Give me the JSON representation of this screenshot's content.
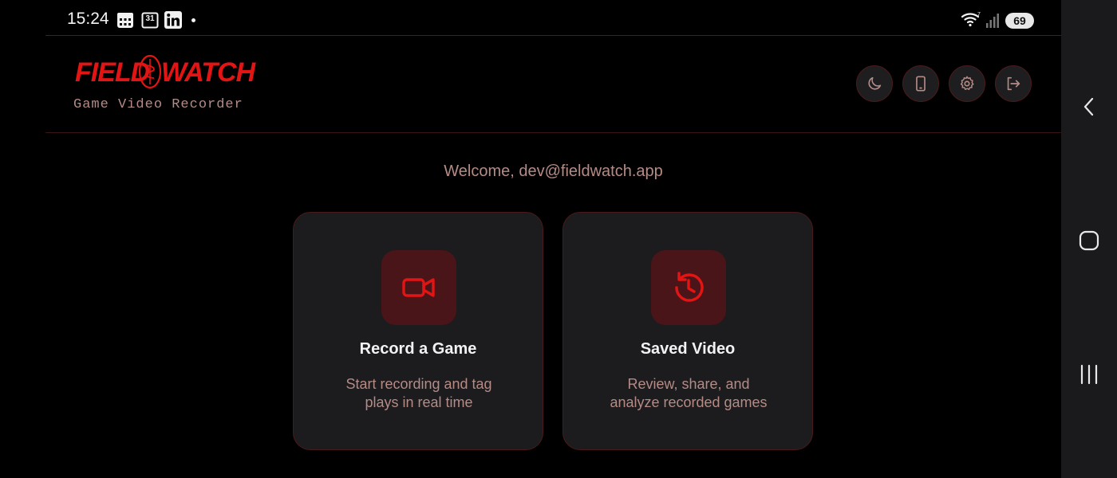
{
  "status_bar": {
    "time": "15:24",
    "calendar_day": "31",
    "battery": "69",
    "icons": [
      "calendar-grid-icon",
      "calendar-date-icon",
      "linkedin-icon",
      "notification-dot-icon",
      "wifi-icon",
      "signal-icon",
      "battery-icon"
    ]
  },
  "header": {
    "logo_left": "FIELD",
    "logo_right": "WATCH",
    "subtitle": "Game Video Recorder",
    "buttons": [
      "moon-icon",
      "phone-icon",
      "gear-icon",
      "logout-icon"
    ]
  },
  "welcome": "Welcome, dev@fieldwatch.app",
  "cards": [
    {
      "title": "Record a Game",
      "desc_line1": "Start recording and tag",
      "desc_line2": "plays in real time",
      "icon": "video-camera-icon"
    },
    {
      "title": "Saved Video",
      "desc_line1": "Review, share, and",
      "desc_line2": "analyze recorded games",
      "icon": "history-icon"
    }
  ],
  "nav_bar": {
    "icons": [
      "back-icon",
      "home-icon",
      "recents-icon"
    ]
  },
  "colors": {
    "accent": "#e31414",
    "muted_text": "#b58b86",
    "card_bg": "#1c1b1e",
    "icon_box_bg": "#4a1518"
  }
}
